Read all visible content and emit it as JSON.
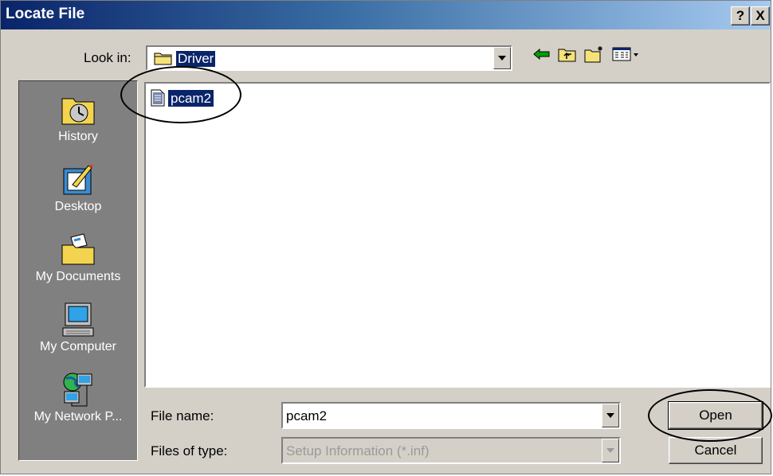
{
  "window": {
    "title": "Locate File",
    "help_button": "?",
    "close_button": "X"
  },
  "lookin": {
    "label": "Look in:",
    "value": "Driver"
  },
  "toolbar": {
    "back_icon": "back-arrow-icon",
    "up_icon": "up-one-level-icon",
    "new_folder_icon": "new-folder-icon",
    "view_menu_icon": "view-menu-icon"
  },
  "places": [
    {
      "label": "History",
      "icon": "history-icon"
    },
    {
      "label": "Desktop",
      "icon": "desktop-icon"
    },
    {
      "label": "My Documents",
      "icon": "my-documents-icon"
    },
    {
      "label": "My Computer",
      "icon": "my-computer-icon"
    },
    {
      "label": "My Network P...",
      "icon": "my-network-places-icon"
    }
  ],
  "files": [
    {
      "name": "pcam2",
      "selected": true,
      "icon": "setup-info-file-icon"
    }
  ],
  "filename": {
    "label": "File name:",
    "value": "pcam2"
  },
  "filetype": {
    "label": "Files of type:",
    "value": "Setup Information (*.inf)"
  },
  "buttons": {
    "open": "Open",
    "cancel": "Cancel"
  },
  "colors": {
    "title_start": "#0a246a",
    "title_end": "#a6caf0",
    "face": "#d4d0c8",
    "selection": "#0a246a"
  }
}
